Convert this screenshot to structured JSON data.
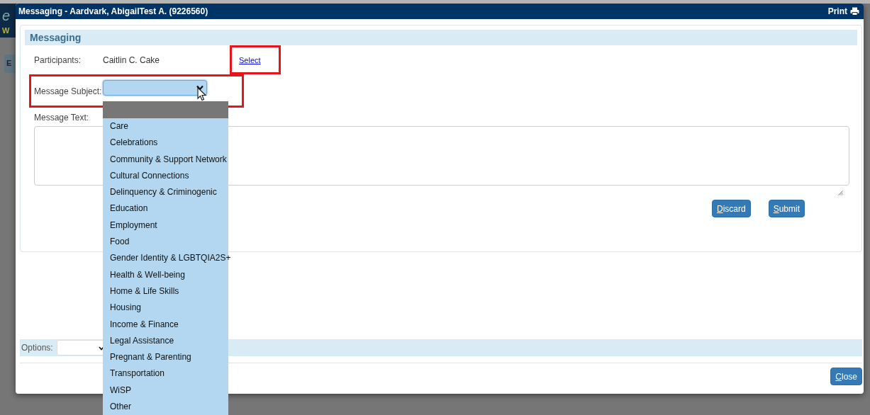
{
  "background_app": {
    "logo_fragment": "e",
    "tagline_fragment": "W",
    "tab_fragment": "E"
  },
  "window": {
    "title": "Messaging - Aardvark, AbigailTest A. (9226560)",
    "print_label": "Print"
  },
  "section": {
    "title": "Messaging"
  },
  "participants": {
    "label": "Participants:",
    "value": "Caitlin C. Cake",
    "select_link": "Select",
    "highlighted": true
  },
  "subject": {
    "label": "Message Subject:",
    "highlighted": true,
    "open": true,
    "blank_option": {
      "selected": true
    },
    "options": [
      {
        "label": "Care",
        "selected": false
      },
      {
        "label": "Celebrations",
        "selected": false
      },
      {
        "label": "Community & Support Network",
        "selected": false
      },
      {
        "label": "Cultural Connections",
        "selected": false
      },
      {
        "label": "Delinquency & Criminogenic",
        "selected": false
      },
      {
        "label": "Education",
        "selected": false
      },
      {
        "label": "Employment",
        "selected": false
      },
      {
        "label": "Food",
        "selected": false
      },
      {
        "label": "Gender Identity & LGBTQIA2S+",
        "selected": false
      },
      {
        "label": "Health & Well-being",
        "selected": false
      },
      {
        "label": "Home & Life Skills",
        "selected": false
      },
      {
        "label": "Housing",
        "selected": false
      },
      {
        "label": "Income & Finance",
        "selected": false
      },
      {
        "label": "Legal Assistance",
        "selected": false
      },
      {
        "label": "Pregnant & Parenting",
        "selected": false
      },
      {
        "label": "Transportation",
        "selected": false
      },
      {
        "label": "WiSP",
        "selected": false
      },
      {
        "label": "Other",
        "selected": false
      }
    ]
  },
  "message_text": {
    "label": "Message Text:"
  },
  "buttons": [
    "Discard",
    "Submit"
  ],
  "options_bar": {
    "label": "Options:"
  },
  "close_button": "Close"
}
